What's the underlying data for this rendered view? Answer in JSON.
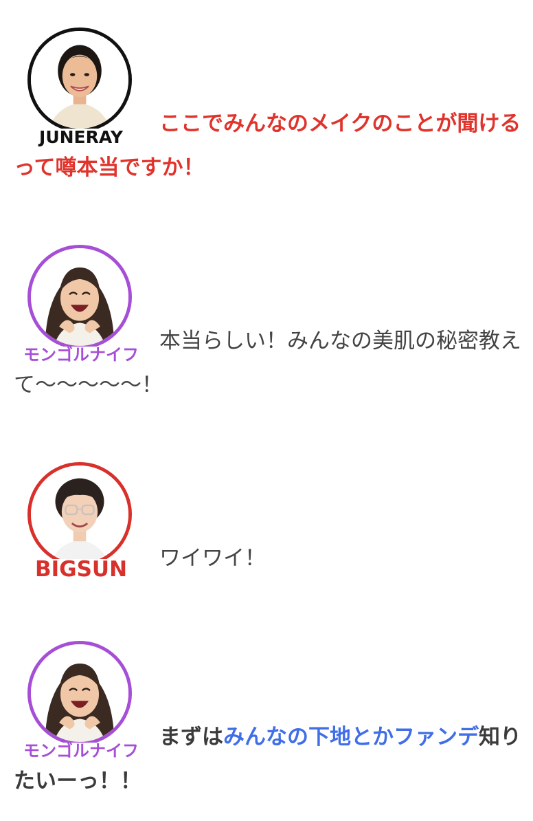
{
  "messages": [
    {
      "speaker": "JUNERAY",
      "ring_color": "#111111",
      "name_color": "#111111",
      "text": "ここでみんなのメイクのことが聞けるって噂本当ですか！",
      "text_color": "#e0332c"
    },
    {
      "speaker": "モンゴルナイフ",
      "ring_color": "#a64fd6",
      "name_color": "#a64fd6",
      "text": "本当らしい！みんなの美肌の秘密教えて〜〜〜〜〜！",
      "text_color": "#444444"
    },
    {
      "speaker": "BIGSUN",
      "ring_color": "#d8302b",
      "name_color": "#d8302b",
      "text": "ワイワイ！",
      "text_color": "#444444"
    },
    {
      "speaker": "モンゴルナイフ",
      "ring_color": "#a64fd6",
      "name_color": "#a64fd6",
      "text_pre": "まずは",
      "text_highlight": "みんなの下地とかファンデ",
      "text_post": "知りたいーっ！！",
      "highlight_color": "#3f6ee8"
    }
  ]
}
